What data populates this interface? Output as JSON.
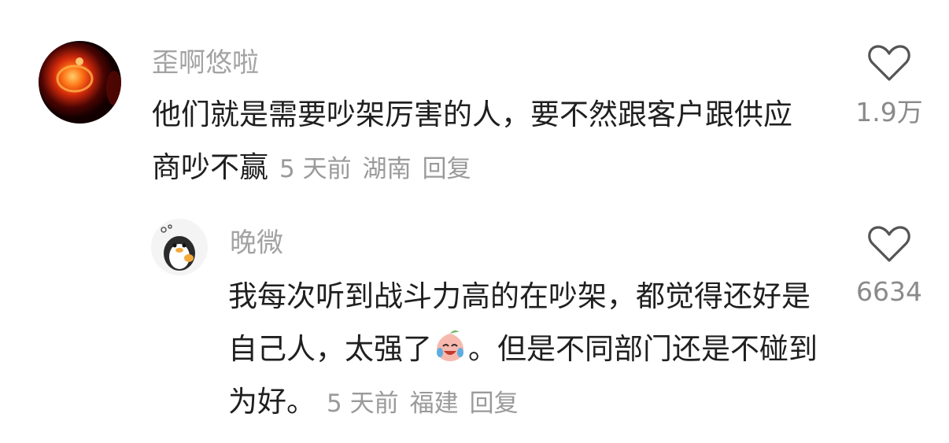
{
  "comments": [
    {
      "username": "歪啊悠啦",
      "text": "他们就是需要吵架厉害的人，要不然跟客户跟供应商吵不赢",
      "time": "5 天前",
      "location": "湖南",
      "reply_label": "回复",
      "likes": "1.9万"
    }
  ],
  "replies": [
    {
      "username": "晚微",
      "text_before_emoji": "我每次听到战斗力高的在吵架，都觉得还好是自己人，太强了",
      "emoji": "crying-laughing-peach-emoji",
      "text_after_emoji": "。但是不同部门还是不碰到为好。",
      "time": "5 天前",
      "location": "福建",
      "reply_label": "回复",
      "likes": "6634"
    }
  ],
  "colors": {
    "username": "#a3a3a3",
    "text": "#1f1f1f",
    "meta": "#9a9a9a",
    "icon": "#555555"
  }
}
